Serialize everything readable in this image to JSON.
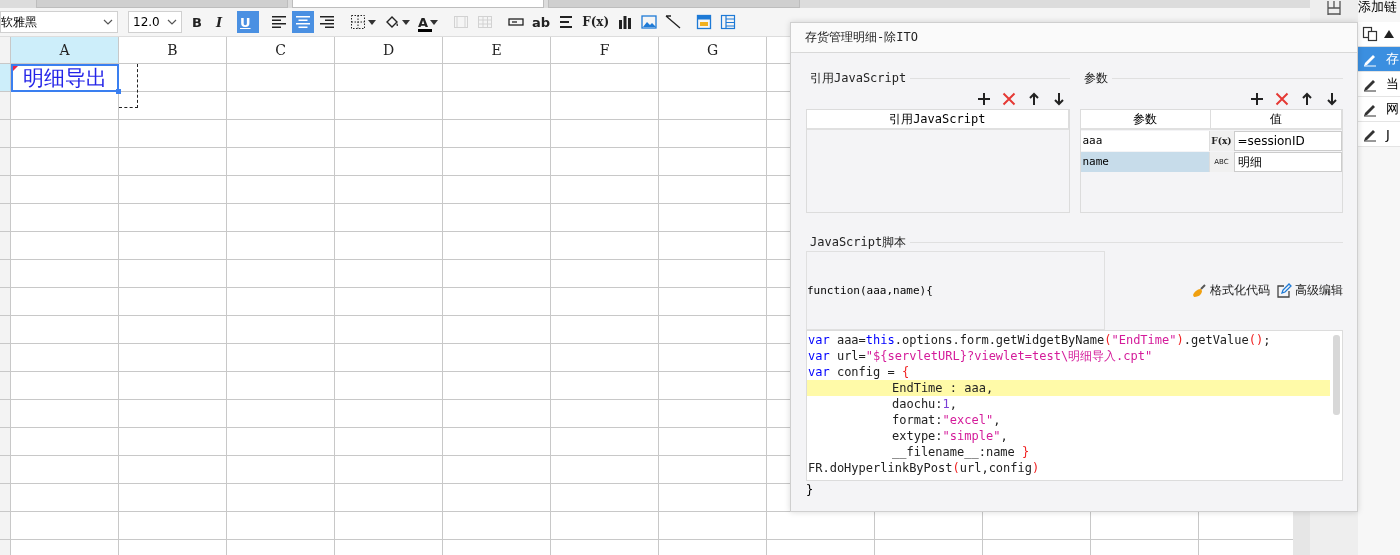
{
  "document_tabs": [
    {
      "selected": false
    },
    {
      "selected": true
    },
    {
      "selected": false
    }
  ],
  "toolbar": {
    "font": "软雅黑",
    "font_size": "12.0",
    "buttons": [
      {
        "kind": "bold",
        "label": "B",
        "selected": false,
        "disabled": false,
        "dropdown": false
      },
      {
        "kind": "italic",
        "label": "I",
        "selected": false,
        "disabled": false,
        "dropdown": false
      },
      {
        "kind": "underline",
        "label": "U",
        "selected": true,
        "disabled": false,
        "dropdown": false
      },
      {
        "kind": "alignleft",
        "selected": false,
        "disabled": false,
        "dropdown": false
      },
      {
        "kind": "aligncenter",
        "selected": true,
        "disabled": false,
        "dropdown": false
      },
      {
        "kind": "alignright",
        "selected": false,
        "disabled": false,
        "dropdown": false
      },
      {
        "kind": "borders",
        "selected": false,
        "disabled": false,
        "dropdown": true
      },
      {
        "kind": "fill",
        "selected": false,
        "disabled": false,
        "dropdown": true
      },
      {
        "kind": "fontcolor",
        "label": "A",
        "selected": false,
        "disabled": false,
        "dropdown": true
      },
      {
        "kind": "merge",
        "selected": false,
        "disabled": true,
        "dropdown": false
      },
      {
        "kind": "grid",
        "selected": false,
        "disabled": true,
        "dropdown": false
      },
      {
        "kind": "textfield",
        "selected": false,
        "disabled": false,
        "dropdown": false
      },
      {
        "kind": "label",
        "label": "ab",
        "selected": false,
        "disabled": false,
        "dropdown": false
      },
      {
        "kind": "lines",
        "selected": false,
        "disabled": false,
        "dropdown": false
      },
      {
        "kind": "formula",
        "label": "F(x)",
        "selected": false,
        "disabled": false,
        "dropdown": false
      },
      {
        "kind": "chart",
        "selected": false,
        "disabled": false,
        "dropdown": false
      },
      {
        "kind": "image",
        "selected": false,
        "disabled": false,
        "dropdown": false
      },
      {
        "kind": "slash",
        "selected": false,
        "disabled": false,
        "dropdown": false
      },
      {
        "kind": "form",
        "selected": false,
        "disabled": false,
        "dropdown": false
      },
      {
        "kind": "layout",
        "selected": false,
        "disabled": false,
        "dropdown": false
      }
    ]
  },
  "sheet": {
    "columns": [
      {
        "label": "A",
        "selected": true
      },
      {
        "label": "B",
        "selected": false
      },
      {
        "label": "C",
        "selected": false
      },
      {
        "label": "D",
        "selected": false
      },
      {
        "label": "E",
        "selected": false
      },
      {
        "label": "F",
        "selected": false
      },
      {
        "label": "G",
        "selected": false
      }
    ],
    "cell_a1": "明细导出"
  },
  "dialog": {
    "title": "存货管理明细-除ITO",
    "script_refs": {
      "title": "引用JavaScript",
      "column": "引用JavaScript"
    },
    "params": {
      "title": "参数",
      "columns": [
        "参数",
        "值"
      ],
      "rows": [
        {
          "name": "aaa",
          "kind": "formula",
          "type_label": "F(x)",
          "value": "=sessionID",
          "selected": false
        },
        {
          "name": "name",
          "kind": "string",
          "type_label": "ABC",
          "value": "明细",
          "selected": true
        }
      ]
    },
    "script": {
      "title": "JavaScript脚本",
      "signature": "function(aaa,name){",
      "format_button": "格式化代码",
      "advanced_button": "高级编辑",
      "lines": [
        {
          "indented": false,
          "highlighted": false,
          "tokens": [
            {
              "kind": "keyword",
              "text": "var"
            },
            {
              "kind": "plain",
              "text": " aaa="
            },
            {
              "kind": "keyword",
              "text": "this"
            },
            {
              "kind": "plain",
              "text": ".options.form.getWidgetByName"
            },
            {
              "kind": "bracket",
              "text": "("
            },
            {
              "kind": "string",
              "text": "\"EndTime\""
            },
            {
              "kind": "bracket",
              "text": ")"
            },
            {
              "kind": "plain",
              "text": ".getValue"
            },
            {
              "kind": "bracket",
              "text": "()"
            },
            {
              "kind": "plain",
              "text": ";"
            }
          ]
        },
        {
          "indented": false,
          "highlighted": false,
          "tokens": [
            {
              "kind": "keyword",
              "text": "var"
            },
            {
              "kind": "plain",
              "text": " url="
            },
            {
              "kind": "string",
              "text": "\"${servletURL}?viewlet=test\\明细导入.cpt\""
            }
          ]
        },
        {
          "indented": false,
          "highlighted": false,
          "tokens": [
            {
              "kind": "keyword",
              "text": "var"
            },
            {
              "kind": "plain",
              "text": " config = "
            },
            {
              "kind": "bracket",
              "text": "{"
            }
          ]
        },
        {
          "indented": true,
          "highlighted": true,
          "tokens": [
            {
              "kind": "plain",
              "text": "EndTime : aaa,"
            }
          ]
        },
        {
          "indented": true,
          "highlighted": false,
          "tokens": [
            {
              "kind": "plain",
              "text": "daochu:"
            },
            {
              "kind": "number",
              "text": "1"
            },
            {
              "kind": "plain",
              "text": ","
            }
          ]
        },
        {
          "indented": true,
          "highlighted": false,
          "tokens": [
            {
              "kind": "plain",
              "text": "format:"
            },
            {
              "kind": "string",
              "text": "\"excel\""
            },
            {
              "kind": "plain",
              "text": ","
            }
          ]
        },
        {
          "indented": true,
          "highlighted": false,
          "tokens": [
            {
              "kind": "plain",
              "text": "extype:"
            },
            {
              "kind": "string",
              "text": "\"simple\""
            },
            {
              "kind": "plain",
              "text": ","
            }
          ]
        },
        {
          "indented": true,
          "highlighted": false,
          "tokens": [
            {
              "kind": "plain",
              "text": "__filename__:name "
            },
            {
              "kind": "bracket",
              "text": "}"
            }
          ]
        },
        {
          "indented": false,
          "highlighted": false,
          "tokens": [
            {
              "kind": "plain",
              "text": "FR.doHyperlinkByPost"
            },
            {
              "kind": "bracket",
              "text": "("
            },
            {
              "kind": "plain",
              "text": "url,config"
            },
            {
              "kind": "bracket",
              "text": ")"
            }
          ]
        }
      ],
      "closing": "}"
    }
  },
  "side_panel": {
    "title": "添加链",
    "items": [
      {
        "label": "存",
        "selected": true
      },
      {
        "label": "当",
        "selected": false
      },
      {
        "label": "网",
        "selected": false
      },
      {
        "label": "J",
        "selected": false
      }
    ]
  }
}
